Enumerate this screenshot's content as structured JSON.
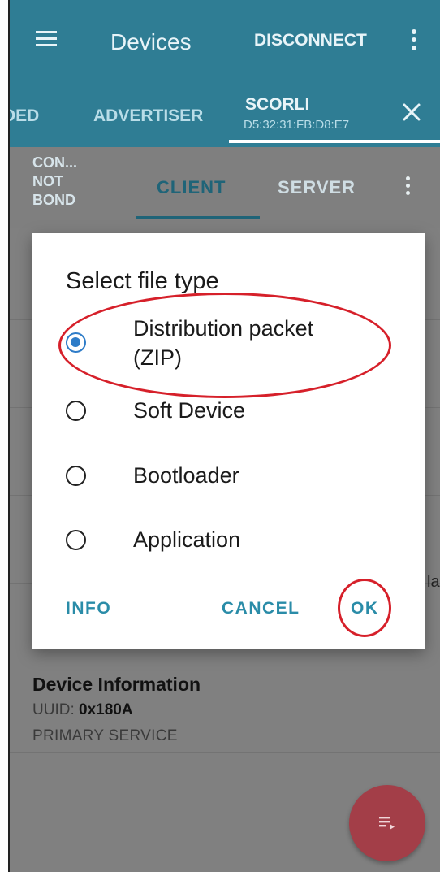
{
  "appbar": {
    "title": "Devices",
    "disconnect": "DISCONNECT"
  },
  "device_tabs": {
    "partial": "DED",
    "advertiser": "ADVERTISER",
    "active_name": "SCORLI",
    "active_address": "D5:32:31:FB:D8:E7"
  },
  "subtabs": {
    "bond_line1": "CON...",
    "bond_line2": "NOT",
    "bond_line3": "BOND",
    "client": "CLIENT",
    "server": "SERVER"
  },
  "background": {
    "edge_text": "la",
    "service_name": "Device Information",
    "uuid_label": "UUID:",
    "uuid_value": "0x180A",
    "service_type": "PRIMARY SERVICE"
  },
  "dialog": {
    "title": "Select file type",
    "options": [
      {
        "label_line1": "Distribution packet",
        "label_line2": "(ZIP)",
        "checked": true
      },
      {
        "label": "Soft Device",
        "checked": false
      },
      {
        "label": "Bootloader",
        "checked": false
      },
      {
        "label": "Application",
        "checked": false
      }
    ],
    "info": "INFO",
    "cancel": "CANCEL",
    "ok": "OK"
  },
  "colors": {
    "appbar": "#2f7d94",
    "accent": "#2a8ca8",
    "radio_checked": "#2e7cc8",
    "annotation": "#d6202a",
    "fab": "#a33e48"
  }
}
